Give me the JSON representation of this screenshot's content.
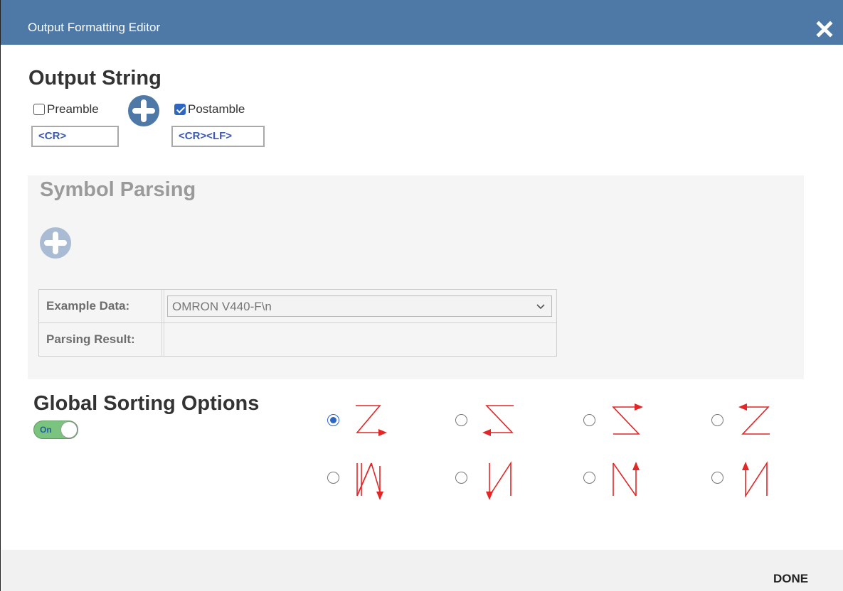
{
  "dialog": {
    "title": "Output Formatting Editor",
    "close_icon": "close-icon"
  },
  "output_string": {
    "heading": "Output String",
    "preamble": {
      "label": "Preamble",
      "checked": false,
      "value": "<CR>"
    },
    "postamble": {
      "label": "Postamble",
      "checked": true,
      "value": "<CR><LF>"
    },
    "add_icon": "plus-circle-icon"
  },
  "symbol_parsing": {
    "heading": "Symbol Parsing",
    "add_icon": "plus-circle-icon",
    "example_data_label": "Example Data:",
    "example_data_value": "OMRON V440-F\\n",
    "parsing_result_label": "Parsing Result:",
    "parsing_result_value": ""
  },
  "global_sorting": {
    "heading": "Global Sorting Options",
    "toggle_label": "On",
    "toggle_on": true,
    "selected_index": 0,
    "options": [
      {
        "name": "z-right-down"
      },
      {
        "name": "s-left-down"
      },
      {
        "name": "s-right-up"
      },
      {
        "name": "z-left-up"
      },
      {
        "name": "n-down-right"
      },
      {
        "name": "n-down-left"
      },
      {
        "name": "n-up-right"
      },
      {
        "name": "n-up-left"
      }
    ],
    "arrow_color": "#e32626"
  },
  "footer": {
    "done_label": "DONE"
  },
  "colors": {
    "titlebar": "#4e79a7",
    "accent": "#2f66c0",
    "toggle_on": "#7bc47f",
    "panel": "#f5f5f5"
  }
}
